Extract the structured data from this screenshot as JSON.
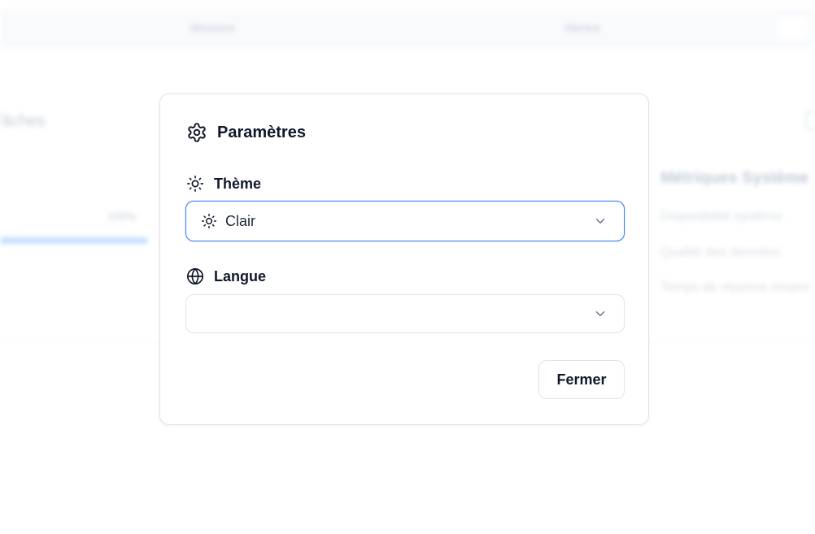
{
  "background": {
    "header": {
      "items": [
        "Missions",
        "Alertes"
      ]
    },
    "left_panel": {
      "title": "Tâches",
      "percent": "100%"
    },
    "right_panel": {
      "title": "Métriques Système",
      "lines": [
        "Disponibilité système",
        "Qualité des données",
        "Temps de réponse moyen"
      ]
    }
  },
  "modal": {
    "title": "Paramètres",
    "title_icon": "gear-icon",
    "theme": {
      "label": "Thème",
      "label_icon": "sun-icon",
      "value": "Clair",
      "value_icon": "sun-icon"
    },
    "language": {
      "label": "Langue",
      "label_icon": "globe-icon",
      "value": ""
    },
    "close_label": "Fermer"
  },
  "colors": {
    "focus_border": "#3b82f6",
    "text": "#0f172a",
    "border": "#dfe3e8"
  }
}
